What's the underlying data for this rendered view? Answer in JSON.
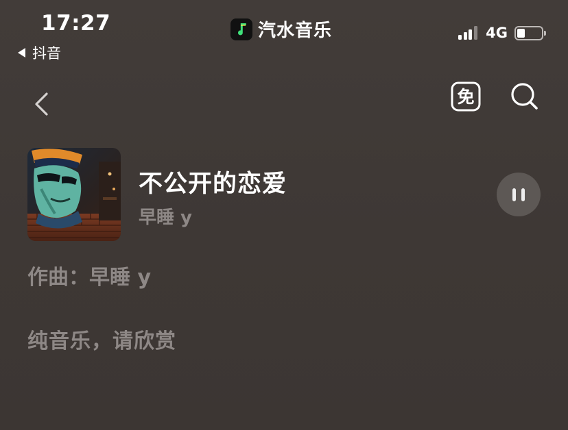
{
  "status_bar": {
    "time": "17:27",
    "back_app": "抖音",
    "app_name": "汽水音乐",
    "network": "4G"
  },
  "nav": {
    "back_icon": "chevron-left-icon",
    "free_icon": "free-badge-icon",
    "free_label": "免",
    "search_icon": "search-icon"
  },
  "song": {
    "title": "不公开的恋爱",
    "artist": "早睡 y",
    "playback_state": "playing",
    "button_icon": "pause-icon"
  },
  "description": {
    "composer_label": "作曲：",
    "composer_name": "早睡 y",
    "note": "纯音乐，请欣赏"
  },
  "colors": {
    "background": "#3f3a37",
    "primary_text": "#ffffff",
    "secondary_text": "#8e8886",
    "play_button_bg": "#5d5855"
  }
}
